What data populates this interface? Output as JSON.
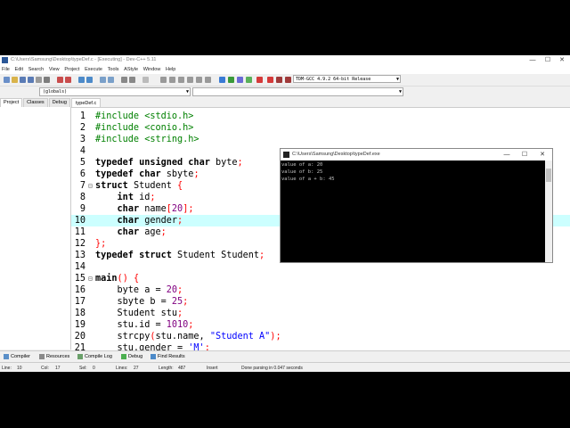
{
  "window": {
    "title": "C:\\Users\\Samsung\\Desktop\\typeDef.c - [Executing] - Dev-C++ 5.11",
    "controls": [
      "—",
      "☐",
      "✕"
    ]
  },
  "menu": [
    "File",
    "Edit",
    "Search",
    "View",
    "Project",
    "Execute",
    "Tools",
    "AStyle",
    "Window",
    "Help"
  ],
  "toolbar": {
    "compiler": "TDM-GCC 4.9.2 64-bit Release"
  },
  "combos": {
    "globals": "(globals)",
    "second": ""
  },
  "left_tabs": [
    "Project",
    "Classes",
    "Debug"
  ],
  "file_tab": "typeDef.c",
  "editor": {
    "highlighted_line": 10,
    "lines": [
      {
        "n": "1",
        "fold": "",
        "code": "#include <stdio.h>"
      },
      {
        "n": "2",
        "fold": "",
        "code": "#include <conio.h>"
      },
      {
        "n": "3",
        "fold": "",
        "code": "#include <string.h>"
      },
      {
        "n": "4",
        "fold": "",
        "code": ""
      },
      {
        "n": "5",
        "fold": "",
        "code": "typedef unsigned char byte;"
      },
      {
        "n": "6",
        "fold": "",
        "code": "typedef char sbyte;"
      },
      {
        "n": "7",
        "fold": "⊟",
        "code": "struct Student {"
      },
      {
        "n": "8",
        "fold": "",
        "code": "    int id;"
      },
      {
        "n": "9",
        "fold": "",
        "code": "    char name[20];"
      },
      {
        "n": "10",
        "fold": "",
        "code": "    char gender;"
      },
      {
        "n": "11",
        "fold": "",
        "code": "    char age;"
      },
      {
        "n": "12",
        "fold": "",
        "code": "};"
      },
      {
        "n": "13",
        "fold": "",
        "code": "typedef struct Student Student;"
      },
      {
        "n": "14",
        "fold": "",
        "code": ""
      },
      {
        "n": "15",
        "fold": "⊟",
        "code": "main() {"
      },
      {
        "n": "16",
        "fold": "",
        "code": "    byte a = 20;"
      },
      {
        "n": "17",
        "fold": "",
        "code": "    sbyte b = 25;"
      },
      {
        "n": "18",
        "fold": "",
        "code": "    Student stu;"
      },
      {
        "n": "19",
        "fold": "",
        "code": "    stu.id = 1010;"
      },
      {
        "n": "20",
        "fold": "",
        "code": "    strcpy(stu.name, \"Student A\");"
      },
      {
        "n": "21",
        "fold": "",
        "code": "    stu.gender = 'M';"
      }
    ]
  },
  "console": {
    "title": "C:\\Users\\Samsung\\Desktop\\typeDef.exe",
    "lines": [
      "value of a: 20",
      "value of b: 25",
      "value of a + b: 45"
    ]
  },
  "bottom_tabs": [
    "Compiler",
    "Resources",
    "Compile Log",
    "Debug",
    "Find Results"
  ],
  "status": {
    "line": "Line:",
    "line_val": "10",
    "col": "Col:",
    "col_val": "17",
    "sel": "Sel:",
    "sel_val": "0",
    "lines": "Lines:",
    "lines_val": "27",
    "length": "Length:",
    "length_val": "487",
    "mode": "Insert",
    "message": "Done parsing in 0.047 seconds"
  },
  "colors": {
    "preprocessor": "#008000",
    "keyword": "#000000",
    "number": "#800080",
    "string": "#0000ff",
    "brace": "#ff0000",
    "highlight": "#ccffff"
  }
}
